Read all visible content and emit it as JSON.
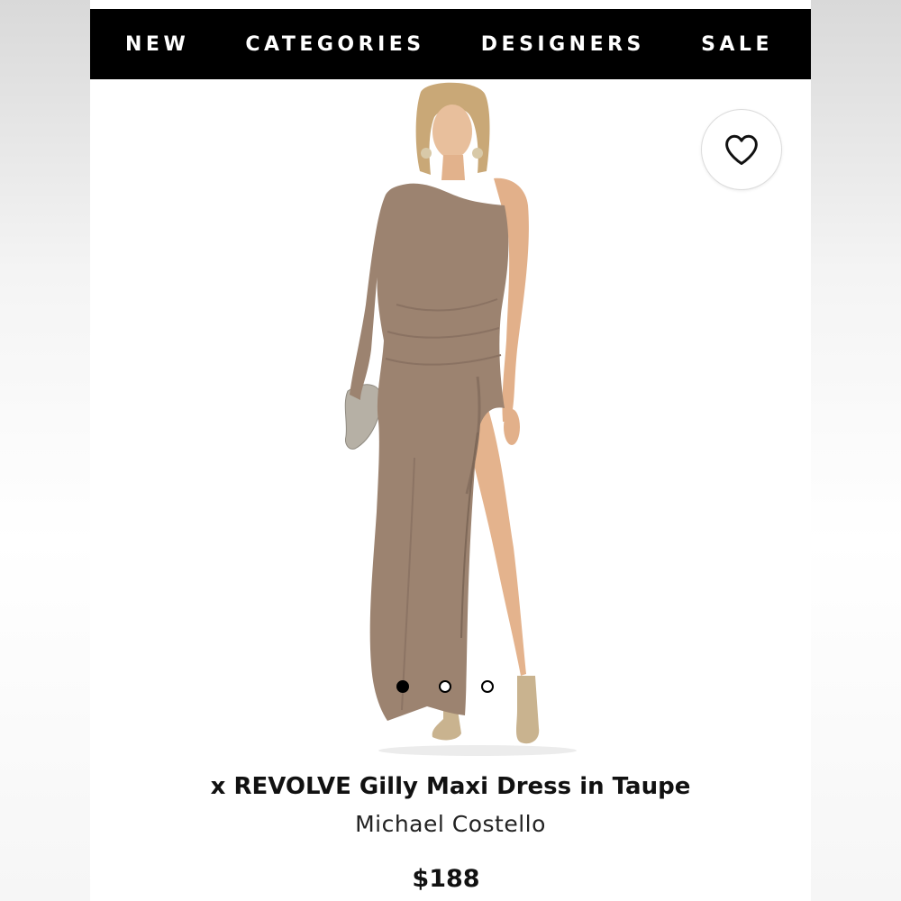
{
  "nav": {
    "items": [
      "NEW",
      "CATEGORIES",
      "DESIGNERS",
      "SALE"
    ]
  },
  "product": {
    "title": "x REVOLVE Gilly Maxi Dress in Taupe",
    "designer": "Michael Costello",
    "price": "$188",
    "dress_color": "#9c8370"
  },
  "gallery": {
    "image_count": 3,
    "active_index": 0
  },
  "icons": {
    "wishlist": "heart-outline-icon"
  },
  "colors": {
    "nav_background": "#000000",
    "nav_text": "#ffffff",
    "text": "#111111"
  }
}
